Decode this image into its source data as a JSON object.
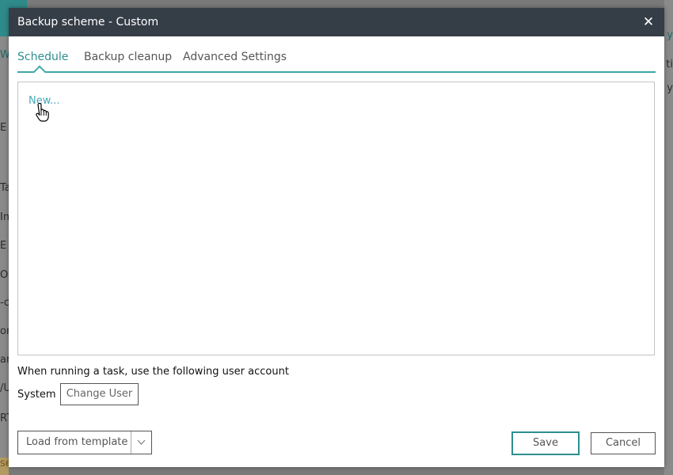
{
  "dialog": {
    "title": "Backup scheme - Custom",
    "close_icon": "close-icon"
  },
  "tabs": [
    {
      "label": "Schedule",
      "active": true
    },
    {
      "label": "Backup cleanup",
      "active": false
    },
    {
      "label": "Advanced Settings",
      "active": false
    }
  ],
  "schedule": {
    "new_link": "New...",
    "account_text": "When running a task, use the following user account",
    "account_value": "System",
    "change_user_label": "Change User"
  },
  "footer": {
    "load_template_label": "Load from template",
    "load_template_icon": "chevron-down-icon",
    "save_label": "Save",
    "cancel_label": "Cancel"
  },
  "background": {
    "left_fragments": [
      "W",
      "E",
      "Ta",
      "Im",
      "E",
      "Op",
      "-co",
      "on",
      "ar",
      "/U",
      "RT",
      "se"
    ],
    "right_fragments": [
      "y",
      "ti",
      "y"
    ]
  },
  "colors": {
    "accent": "#3fa7a7",
    "titlebar": "#353d47",
    "link": "#48a9b8"
  }
}
